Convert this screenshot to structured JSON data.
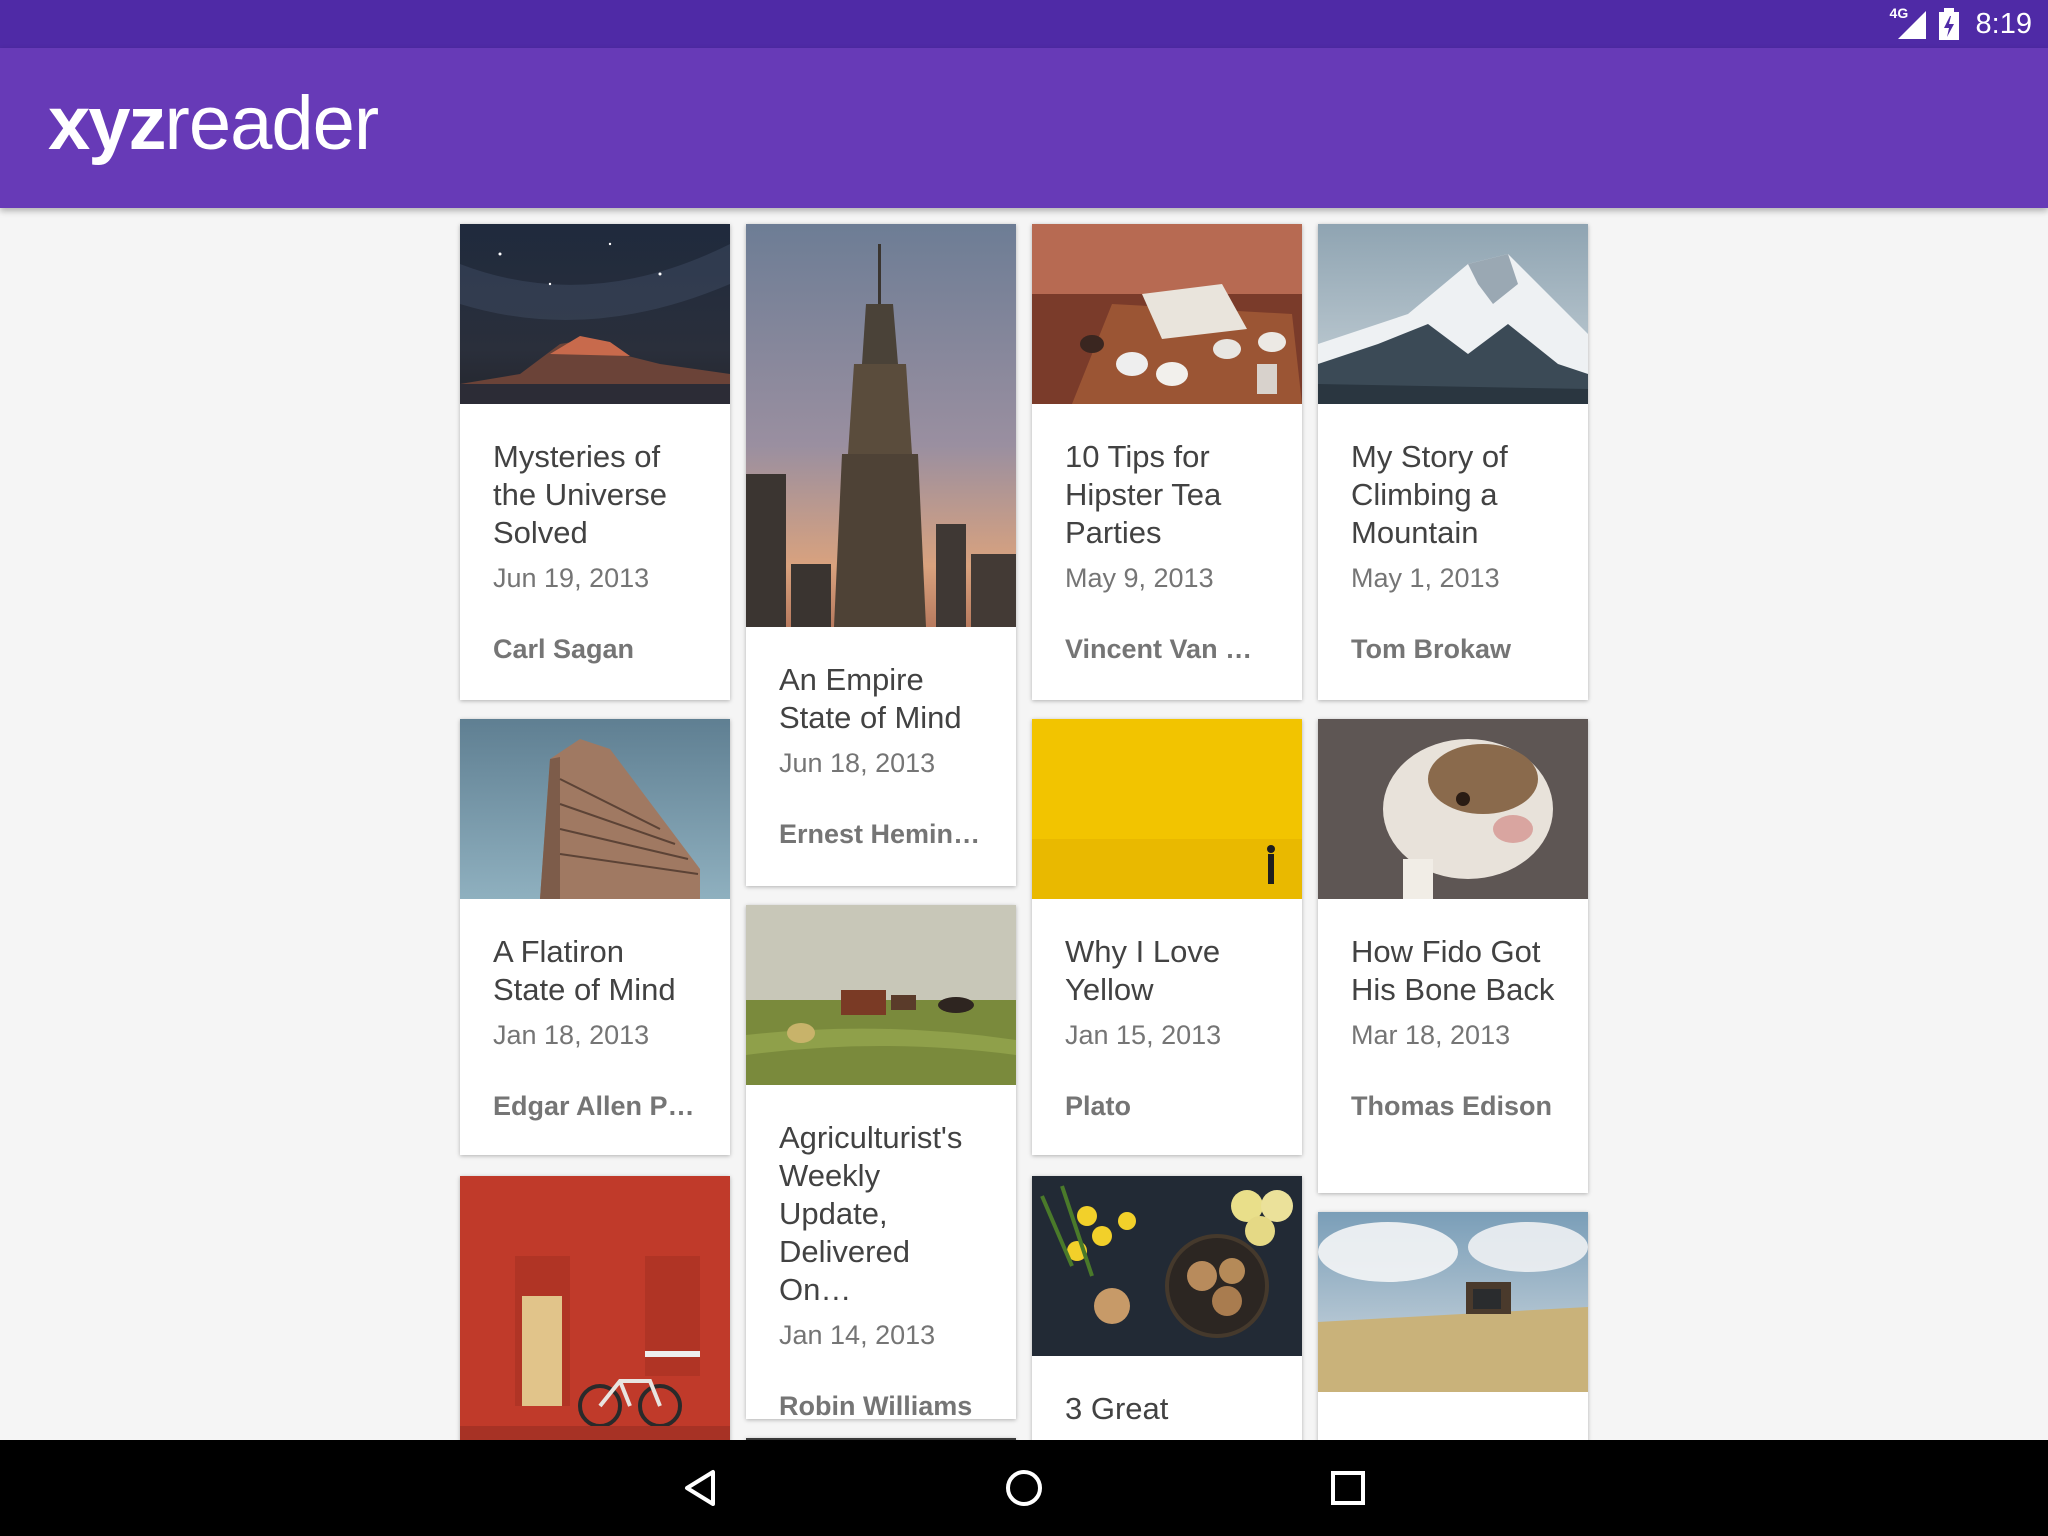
{
  "status_bar": {
    "network_label": "4G",
    "time": "8:19"
  },
  "app": {
    "logo_bold": "xyz",
    "logo_regular": "reader",
    "primary_color": "#673ab7",
    "status_color": "#4f2aa6"
  },
  "cards": [
    {
      "title": "Mysteries of the Universe Solved",
      "date": "Jun 19, 2013",
      "author": "Carl Sagan",
      "image": "night-sky-image"
    },
    {
      "title": "An Empire State of Mind",
      "date": "Jun 18, 2013",
      "author": "Ernest Heming…",
      "image": "empire-state-building-image"
    },
    {
      "title": "10 Tips for Hipster Tea Parties",
      "date": "May 9, 2013",
      "author": "Vincent Van G…",
      "image": "tea-cups-image"
    },
    {
      "title": "My Story of Climbing a Mountain",
      "date": "May 1, 2013",
      "author": "Tom Brokaw",
      "image": "snowy-mountain-image"
    },
    {
      "title": "A Flatiron State of Mind",
      "date": "Jan 18, 2013",
      "author": "Edgar Allen Poe",
      "image": "flatiron-building-image"
    },
    {
      "title": "Agriculturist's Weekly Update, Delivered On…",
      "date": "Jan 14, 2013",
      "author": "Robin Williams",
      "image": "farm-field-image"
    },
    {
      "title": "Why I Love Yellow",
      "date": "Jan 15, 2013",
      "author": "Plato",
      "image": "yellow-wall-image"
    },
    {
      "title": "How Fido Got His Bone Back",
      "date": "Mar 18, 2013",
      "author": "Thomas Edison",
      "image": "bulldog-image"
    },
    {
      "title": "",
      "date": "",
      "author": "",
      "image": "red-brick-wall-image"
    },
    {
      "title": "3 Great",
      "date": "",
      "author": "",
      "image": "flowers-cookies-image"
    },
    {
      "title": "",
      "date": "",
      "author": "",
      "image": "tv-on-beach-image"
    }
  ],
  "nav_bar": {
    "back": "back-icon",
    "home": "home-icon",
    "recents": "recents-icon"
  }
}
